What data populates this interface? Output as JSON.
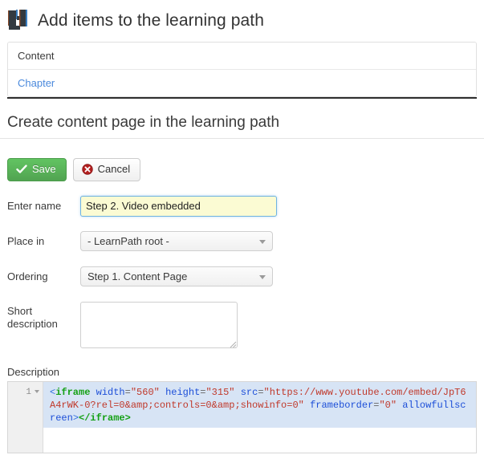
{
  "header": {
    "title": "Add items to the learning path",
    "icon": "learning-path-logo-icon"
  },
  "item_list": {
    "items": [
      {
        "label": "Content",
        "style": "plain"
      },
      {
        "label": "Chapter",
        "style": "link"
      }
    ]
  },
  "section": {
    "heading": "Create content page in the learning path"
  },
  "toolbar": {
    "save_label": "Save",
    "save_icon": "check-icon",
    "save_color": "#51a351",
    "cancel_label": "Cancel",
    "cancel_icon": "error-circle-icon",
    "cancel_icon_color": "#b42020"
  },
  "form": {
    "name": {
      "label": "Enter name",
      "value": "Step 2. Video embedded",
      "placeholder": "",
      "focus_color": "#6fb3e0",
      "background": "#fbfbd3"
    },
    "place_in": {
      "label": "Place in",
      "value": "- LearnPath root -"
    },
    "ordering": {
      "label": "Ordering",
      "value": "Step 1. Content Page"
    },
    "short_description": {
      "label": "Short description",
      "value": "",
      "placeholder": ""
    },
    "description": {
      "label": "Description",
      "line_number": "1",
      "code": {
        "open_lt": "<",
        "tag_open": "iframe",
        "attr_width": "width",
        "val_width": "\"560\"",
        "attr_height": "height",
        "val_height": "\"315\"",
        "attr_src": "src",
        "val_src": "\"https://www.youtube.com/embed/JpT6A4rWK-0?rel=0&amp;controls=0&amp;showinfo=0\"",
        "attr_frameborder": "frameborder",
        "val_frameborder": "\"0\"",
        "attr_allowfullscreen": "allowfullscreen",
        "close_gt": ">",
        "closing_tag": "</iframe>",
        "full_text": "<iframe width=\"560\" height=\"315\" src=\"https://www.youtube.com/embed/JpT6A4rWK-0?rel=0&amp;controls=0&amp;showinfo=0\" frameborder=\"0\" allowfullscreen></iframe>"
      }
    }
  }
}
